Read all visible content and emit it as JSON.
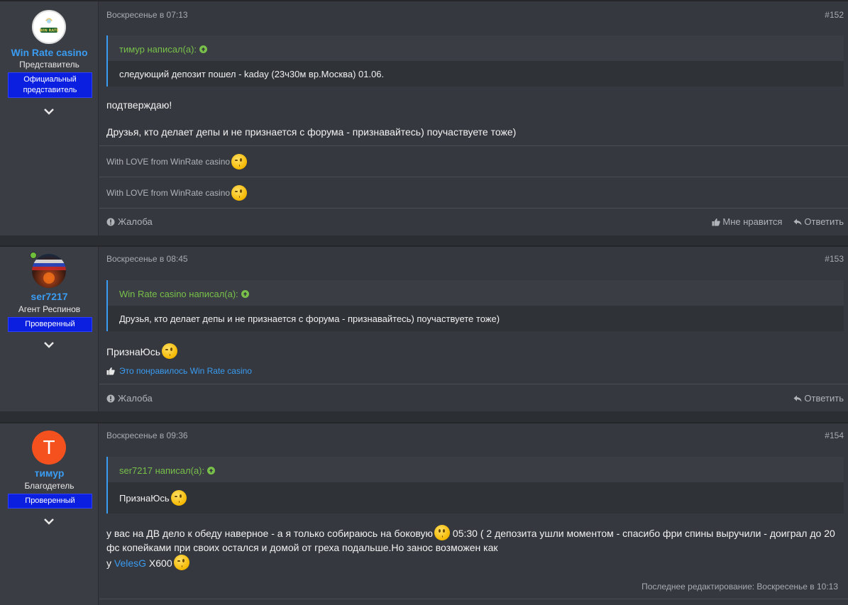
{
  "posts": [
    {
      "user": {
        "name": "Win Rate casino",
        "title": "Представитель",
        "badge_line1": "Официальный",
        "badge_line2": "представитель",
        "logo_text": "WIN RATE"
      },
      "date": "Воскресенье в 07:13",
      "number": "#152",
      "quote": {
        "author": "тимур написал(а):",
        "text": "следующий депозит пошел - kaday (23ч30м вр.Москва) 01.06."
      },
      "message_line1": "подтверждаю!",
      "message_line2": "Друзья, кто делает депы и не признается с форума - признавайтесь) поучаствуете тоже)",
      "signature_1": "With LOVE from WinRate casino",
      "signature_2": "With LOVE from WinRate casino",
      "report": "Жалоба",
      "like": "Мне нравится",
      "reply": "Ответить"
    },
    {
      "user": {
        "name": "ser7217",
        "title": "Агент Респинов",
        "badge": "Проверенный"
      },
      "date": "Воскресенье в 08:45",
      "number": "#153",
      "quote": {
        "author": "Win Rate casino написал(а):",
        "text": "Друзья, кто делает депы и не признается с форума - признавайтесь) поучаствуете тоже)"
      },
      "message": "ПризнаЮсь",
      "likes_text": "Это понравилось Win Rate casino",
      "report": "Жалоба",
      "reply": "Ответить"
    },
    {
      "user": {
        "name": "тимур",
        "title": "Благодетель",
        "badge": "Проверенный",
        "avatar_letter": "Т"
      },
      "date": "Воскресенье в 09:36",
      "number": "#154",
      "quote": {
        "author": "ser7217 написал(а):",
        "text": "ПризнаЮсь"
      },
      "message_part1": "у вас на ДВ дело к обеду наверное - а я только собираюсь на боковую",
      "message_part2": " 05:30 ( 2 депозита ушли моментом - спасибо фри спины выручили - доиграл до 20 фс копейками при своих остался и домой от греха подальше.Но занос возможен как",
      "message_prefix": "у ",
      "mention": "VelesG",
      "message_suffix": " Х600",
      "edited": "Последнее редактирование: Воскресенье в 10:13"
    }
  ],
  "colors": {
    "accent": "#3a9cf2",
    "quote_green": "#78c04a",
    "badge_blue": "#0a1fe0",
    "online": "#6dbf3c",
    "avatar_orange": "#f4511e"
  }
}
